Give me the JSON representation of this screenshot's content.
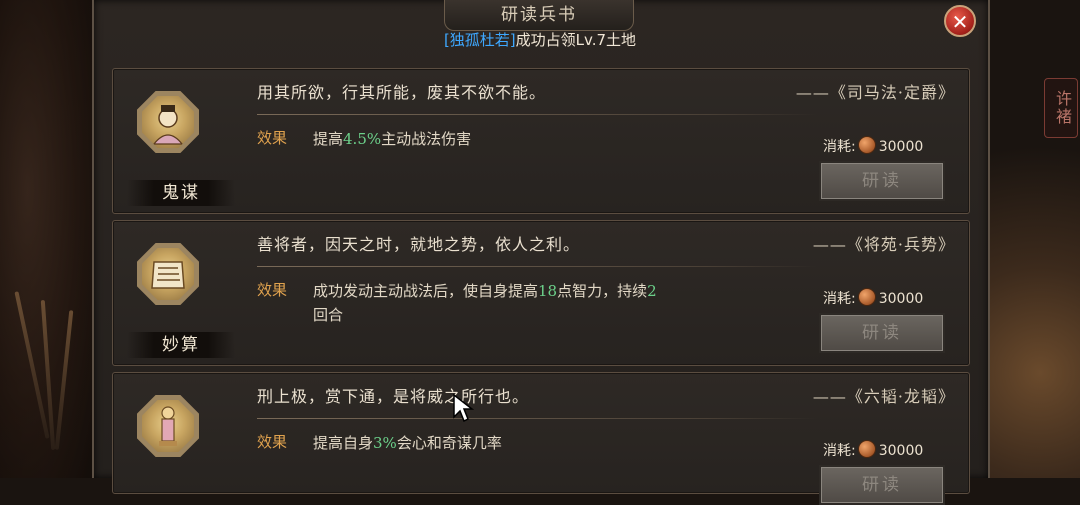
{
  "dialog": {
    "title": "研读兵书",
    "subtitle_name": "[独孤杜若]",
    "subtitle_text": "成功占领Lv.7土地",
    "close_symbol": "✕"
  },
  "side_badge": "许褚",
  "cards": [
    {
      "skill_name": "鬼谋",
      "quote": "用其所欲，行其所能，废其不欲不能。",
      "source": "——《司马法·定爵》",
      "effect_label": "效果",
      "effect_pre": "提高",
      "effect_num": "4.5%",
      "effect_post": "主动战法伤害",
      "effect_num2": "",
      "effect_post2": "",
      "cost_label": "消耗:",
      "cost_value": "30000",
      "button_label": "研读"
    },
    {
      "skill_name": "妙算",
      "quote": "善将者，因天之时，就地之势，依人之利。",
      "source": "——《将苑·兵势》",
      "effect_label": "效果",
      "effect_pre": "成功发动主动战法后，使自身提高",
      "effect_num": "18",
      "effect_post": "点智力，持续",
      "effect_num2": "2",
      "effect_post2": "回合",
      "cost_label": "消耗:",
      "cost_value": "30000",
      "button_label": "研读"
    },
    {
      "skill_name": "",
      "quote": "刑上极，赏下通，是将威之所行也。",
      "source": "——《六韬·龙韬》",
      "effect_label": "效果",
      "effect_pre": "提高自身",
      "effect_num": "3%",
      "effect_post": "会心和奇谋几率",
      "effect_num2": "",
      "effect_post2": "",
      "cost_label": "消耗:",
      "cost_value": "30000",
      "button_label": "研读"
    }
  ],
  "icons": [
    "close-icon",
    "coin-icon",
    "scholar-portrait-icon",
    "scroll-icon",
    "statue-icon",
    "cursor-icon"
  ],
  "colors": {
    "accent_effect": "#e0a24e",
    "number_green": "#6cd08a",
    "name_blue": "#3ea8ff"
  }
}
